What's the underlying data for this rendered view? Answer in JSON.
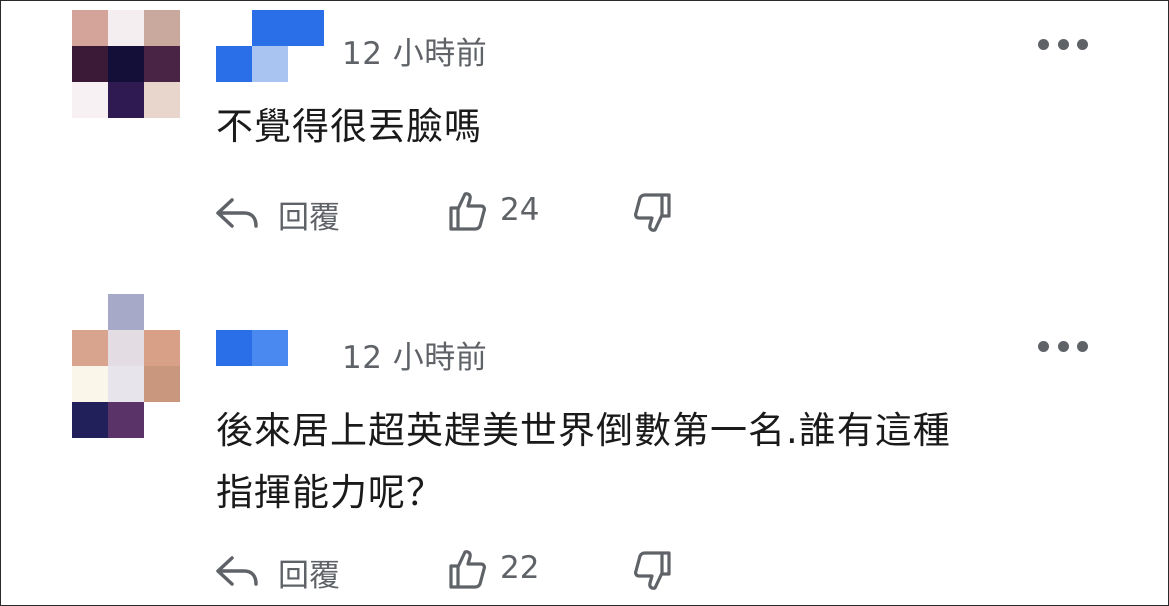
{
  "colors": {
    "text_primary": "#1a1a1a",
    "text_secondary": "#5f6368",
    "username_blur_dark": "#2a6ee8",
    "username_blur_light": "#a9c4f0"
  },
  "comments": [
    {
      "avatar_description": "pixelated-avatar",
      "username": "",
      "timestamp": "12 小時前",
      "text_lines": [
        "不覺得很丟臉嗎"
      ],
      "reply_label": "回覆",
      "likes": "24",
      "icons": [
        "more-icon",
        "reply-icon",
        "thumbs-up-icon",
        "thumbs-down-icon"
      ]
    },
    {
      "avatar_description": "pixelated-avatar",
      "username": "",
      "timestamp": "12 小時前",
      "text_lines": [
        "後來居上超英趕美世界倒數第一名.誰有這種",
        "指揮能力呢？"
      ],
      "reply_label": "回覆",
      "likes": "22",
      "icons": [
        "more-icon",
        "reply-icon",
        "thumbs-up-icon",
        "thumbs-down-icon"
      ]
    }
  ]
}
